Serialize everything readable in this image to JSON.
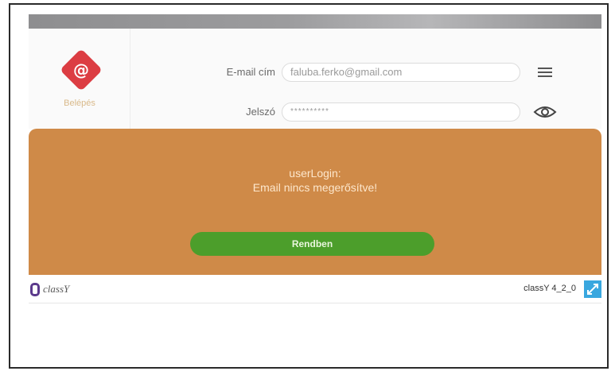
{
  "logo": {
    "symbol": "@",
    "text": "Belépés",
    "color": "#dc3d43"
  },
  "form": {
    "email_label": "E-mail cím",
    "email_value": "faluba.ferko@gmail.com",
    "password_label": "Jelszó",
    "password_value": "**********"
  },
  "icons": {
    "menu": "menu-icon",
    "password_toggle": "eye-icon",
    "expand": "expand-icon"
  },
  "alert": {
    "title": "userLogin:",
    "message": "Email nincs megerősítve!",
    "button_label": "Rendben",
    "background": "#cf8a48",
    "button_color": "#4c9e2b"
  },
  "footer": {
    "brand": "classY",
    "version": "classY 4_2_0",
    "expand_color": "#39a7df"
  }
}
